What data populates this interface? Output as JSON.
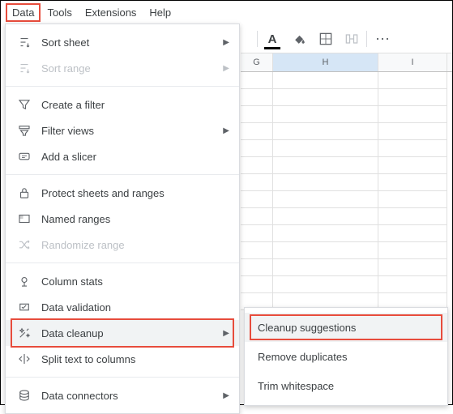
{
  "menubar": {
    "items": [
      "Data",
      "Tools",
      "Extensions",
      "Help"
    ],
    "active": "Data"
  },
  "toolbar": {
    "icons": [
      "text-color",
      "fill-color",
      "borders",
      "merge",
      "more"
    ]
  },
  "dropdown": {
    "groups": [
      [
        {
          "label": "Sort sheet",
          "icon": "sort-icon",
          "submenu": true
        },
        {
          "label": "Sort range",
          "icon": "sort-icon",
          "submenu": true,
          "disabled": true
        }
      ],
      [
        {
          "label": "Create a filter",
          "icon": "filter-icon"
        },
        {
          "label": "Filter views",
          "icon": "filter-views-icon",
          "submenu": true
        },
        {
          "label": "Add a slicer",
          "icon": "slicer-icon"
        }
      ],
      [
        {
          "label": "Protect sheets and ranges",
          "icon": "lock-icon"
        },
        {
          "label": "Named ranges",
          "icon": "named-ranges-icon"
        },
        {
          "label": "Randomize range",
          "icon": "shuffle-icon",
          "disabled": true
        }
      ],
      [
        {
          "label": "Column stats",
          "icon": "stats-icon"
        },
        {
          "label": "Data validation",
          "icon": "validation-icon"
        },
        {
          "label": "Data cleanup",
          "icon": "cleanup-icon",
          "submenu": true,
          "highlighted": true,
          "boxed": true
        },
        {
          "label": "Split text to columns",
          "icon": "split-icon"
        }
      ],
      [
        {
          "label": "Data connectors",
          "icon": "connectors-icon",
          "submenu": true
        }
      ]
    ]
  },
  "submenu": {
    "items": [
      {
        "label": "Cleanup suggestions",
        "highlighted": true,
        "boxed": true
      },
      {
        "label": "Remove duplicates"
      },
      {
        "label": "Trim whitespace"
      }
    ]
  },
  "grid": {
    "columns": [
      "G",
      "H",
      "I"
    ],
    "selected": "H",
    "rows": 14
  }
}
